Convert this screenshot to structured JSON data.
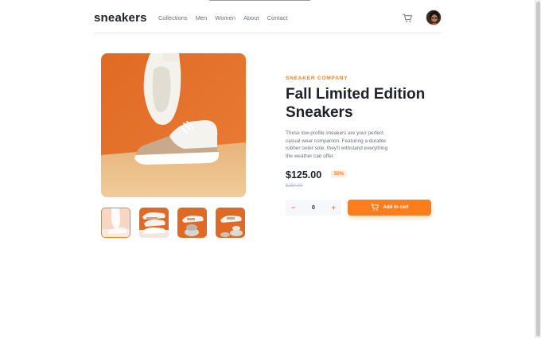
{
  "header": {
    "logo": "sneakers",
    "nav": [
      "Collections",
      "Men",
      "Women",
      "About",
      "Contact"
    ],
    "cart_icon": "cart-icon",
    "avatar_icon": "avatar"
  },
  "gallery": {
    "thumbnail_count": 4,
    "active_thumbnail": 1
  },
  "product": {
    "company": "SNEAKER COMPANY",
    "title": "Fall Limited Edition Sneakers",
    "description": "These low-profile sneakers are your perfect casual wear companion. Featuring a durable rubber outer sole, they'll withstand everything the weather can offer.",
    "price": "$125.00",
    "discount": "50%",
    "old_price": "$250.00"
  },
  "cart_controls": {
    "minus": "−",
    "quantity": "0",
    "plus": "+",
    "add_label": "Add to cart"
  },
  "colors": {
    "accent": "#ff7e1b",
    "accent_pale": "#ffede0",
    "text_dark": "#1d2026",
    "text_muted": "#69707d"
  }
}
